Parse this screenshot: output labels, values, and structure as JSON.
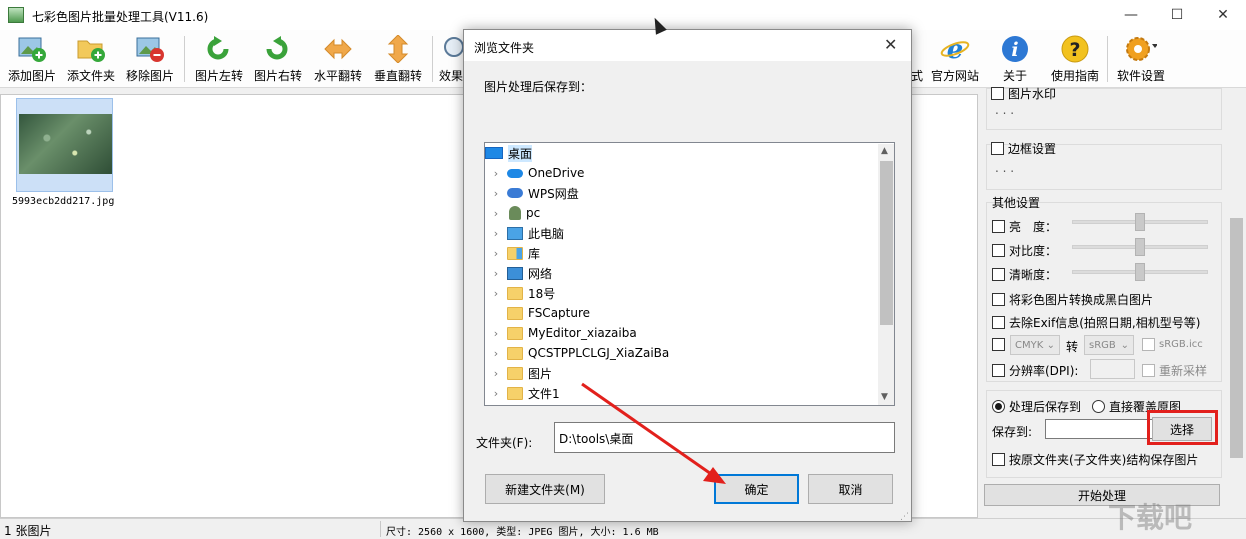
{
  "app": {
    "title": "七彩色图片批量处理工具(V11.6)",
    "controls": {
      "minimize": "—",
      "maximize": "☐",
      "close": "✕"
    }
  },
  "toolbar": {
    "buttons": [
      {
        "label": "添加图片",
        "icon": "add-image-icon"
      },
      {
        "label": "添文件夹",
        "icon": "add-folder-icon"
      },
      {
        "label": "移除图片",
        "icon": "remove-image-icon"
      },
      {
        "label": "图片左转",
        "icon": "rotate-left-icon"
      },
      {
        "label": "图片右转",
        "icon": "rotate-right-icon"
      },
      {
        "label": "水平翻转",
        "icon": "flip-horizontal-icon"
      },
      {
        "label": "垂直翻转",
        "icon": "flip-vertical-icon"
      },
      {
        "label": "效果",
        "icon": "effects-icon"
      },
      {
        "label": "式",
        "icon": "format-icon"
      },
      {
        "label": "官方网站",
        "icon": "ie-icon"
      },
      {
        "label": "关于",
        "icon": "info-icon"
      },
      {
        "label": "使用指南",
        "icon": "help-icon"
      },
      {
        "label": "软件设置",
        "icon": "gear-icon"
      }
    ]
  },
  "images": [
    {
      "filename": "5993ecb2dd217.jpg"
    }
  ],
  "settings": {
    "watermark_label": "图片水印",
    "watermark_dots": ". . .",
    "border_label": "边框设置",
    "border_dots": ". . .",
    "other_title": "其他设置",
    "brightness": "亮　度：",
    "contrast": "对比度：",
    "sharpness": "清晰度：",
    "grayscale": "将彩色图片转换成黑白图片",
    "remove_exif": "去除Exif信息(拍照日期,相机型号等)",
    "cmyk_from": "CMYK",
    "cmyk_to_label": "转",
    "cmyk_to": "sRGB",
    "icc": "sRGB.icc",
    "dpi": "分辨率(DPI):",
    "resample": "重新采样",
    "save_after": "处理后保存到",
    "overwrite": "直接覆盖原图",
    "save_to": "保存到:",
    "save_path": "",
    "choose_button": "选择",
    "keep_structure": "按原文件夹(子文件夹)结构保存图片",
    "start_button": "开始处理"
  },
  "status": {
    "count": "1 张图片",
    "info": "尺寸: 2560 x 1600, 类型: JPEG 图片, 大小: 1.6 MB"
  },
  "dialog": {
    "title": "浏览文件夹",
    "close": "✕",
    "prompt": "图片处理后保存到：",
    "tree": [
      {
        "label": "桌面",
        "icon": "desktop-icon",
        "selected": true
      },
      {
        "label": "OneDrive",
        "icon": "cloud-icon"
      },
      {
        "label": "WPS网盘",
        "icon": "cloud-icon"
      },
      {
        "label": "pc",
        "icon": "user-icon"
      },
      {
        "label": "此电脑",
        "icon": "computer-icon"
      },
      {
        "label": "库",
        "icon": "library-icon"
      },
      {
        "label": "网络",
        "icon": "network-icon"
      },
      {
        "label": "18号",
        "icon": "folder-icon"
      },
      {
        "label": "FSCapture",
        "icon": "folder-icon"
      },
      {
        "label": "MyEditor_xiazaiba",
        "icon": "folder-icon"
      },
      {
        "label": "QCSTPPLCLGJ_XiaZaiBa",
        "icon": "folder-icon"
      },
      {
        "label": "图片",
        "icon": "folder-icon"
      },
      {
        "label": "文件1",
        "icon": "folder-icon"
      }
    ],
    "folder_label": "文件夹(F):",
    "folder_value": "D:\\tools\\桌面",
    "new_folder_button": "新建文件夹(M)",
    "ok_button": "确定",
    "cancel_button": "取消"
  },
  "overlay": {
    "watermark_text": "下载吧",
    "highlight_color": "#e2201c",
    "arrow_color": "#e2201c"
  }
}
